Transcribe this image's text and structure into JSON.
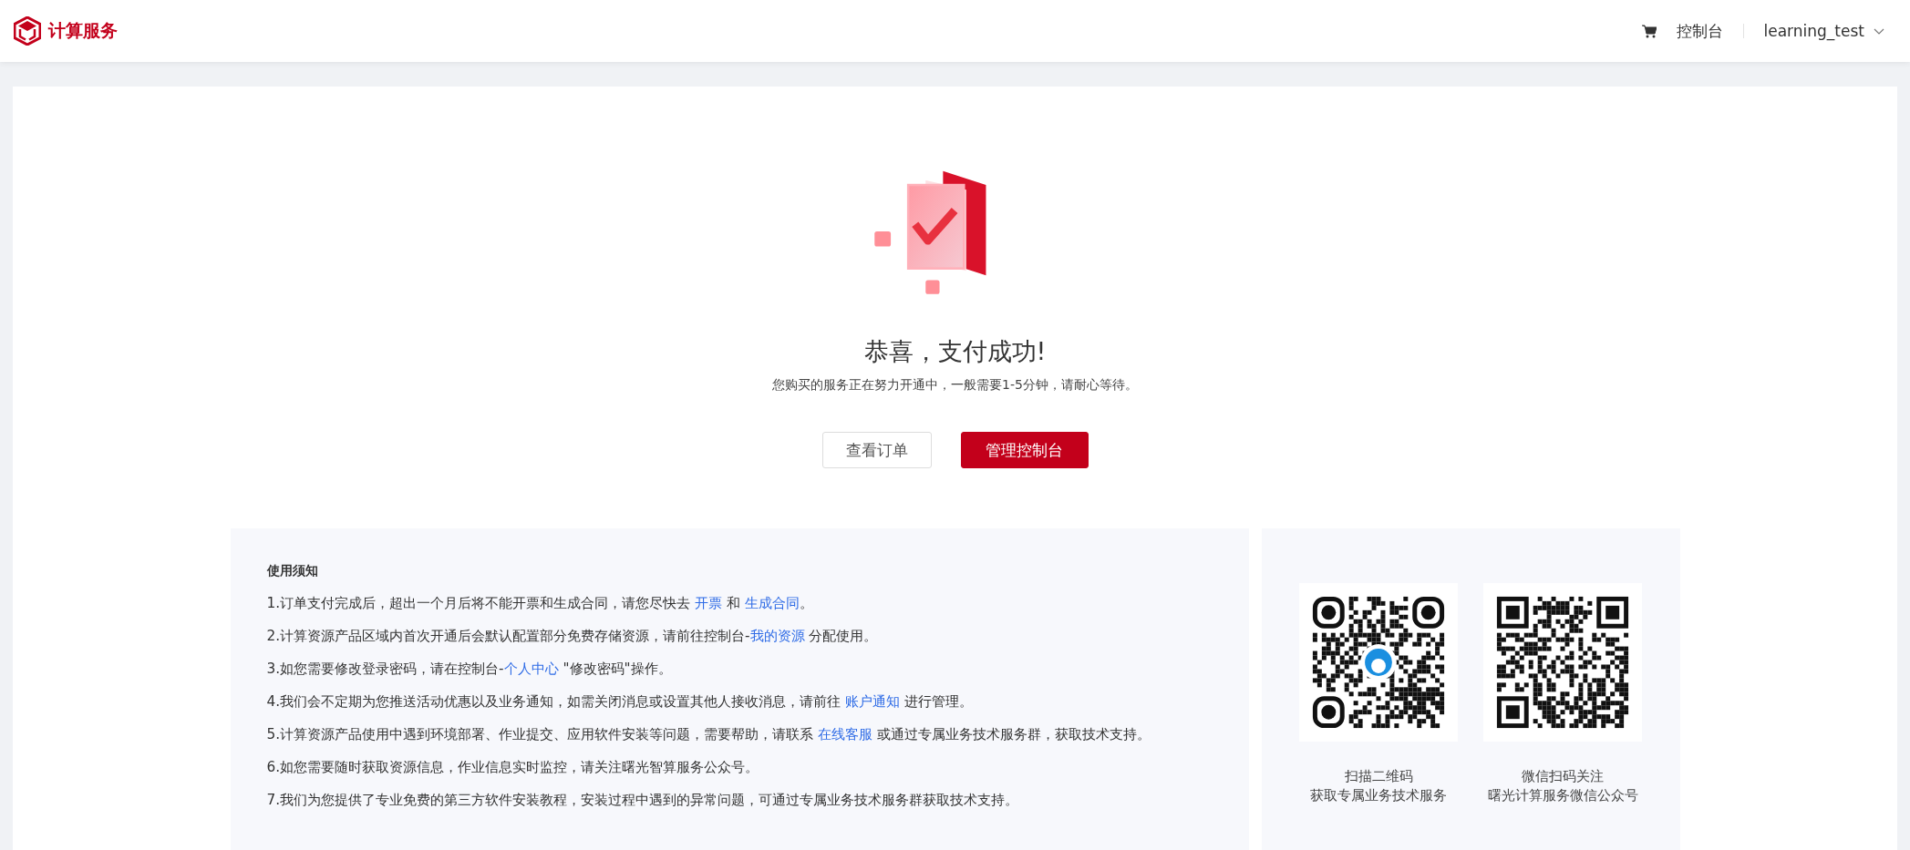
{
  "header": {
    "logo_text": "计算服务",
    "console_link": "控制台",
    "user": "learning_test"
  },
  "result": {
    "title": "恭喜，支付成功!",
    "subtitle": "您购买的服务正在努力开通中，一般需要1-5分钟，请耐心等待。",
    "buttons": [
      {
        "label": "查看订单",
        "kind": "secondary"
      },
      {
        "label": "管理控制台",
        "kind": "primary"
      }
    ]
  },
  "notice": {
    "title": "使用须知",
    "items": [
      [
        {
          "kind": "text",
          "text": "1.订单支付完成后，超出一个月后将不能开票和生成合同，请您尽快去 "
        },
        {
          "kind": "link",
          "text": "开票"
        },
        {
          "kind": "text",
          "text": " 和 "
        },
        {
          "kind": "link",
          "text": "生成合同"
        },
        {
          "kind": "text",
          "text": "。"
        }
      ],
      [
        {
          "kind": "text",
          "text": "2.计算资源产品区域内首次开通后会默认配置部分免费存储资源，请前往控制台-"
        },
        {
          "kind": "link",
          "text": "我的资源"
        },
        {
          "kind": "text",
          "text": " 分配使用。"
        }
      ],
      [
        {
          "kind": "text",
          "text": "3.如您需要修改登录密码，请在控制台-"
        },
        {
          "kind": "link",
          "text": "个人中心"
        },
        {
          "kind": "text",
          "text": " \"修改密码\"操作。"
        }
      ],
      [
        {
          "kind": "text",
          "text": "4.我们会不定期为您推送活动优惠以及业务通知，如需关闭消息或设置其他人接收消息，请前往 "
        },
        {
          "kind": "link",
          "text": "账户通知"
        },
        {
          "kind": "text",
          "text": " 进行管理。"
        }
      ],
      [
        {
          "kind": "text",
          "text": "5.计算资源产品使用中遇到环境部署、作业提交、应用软件安装等问题，需要帮助，请联系 "
        },
        {
          "kind": "link",
          "text": "在线客服"
        },
        {
          "kind": "text",
          "text": " 或通过专属业务技术服务群，获取技术支持。"
        }
      ],
      [
        {
          "kind": "text",
          "text": "6.如您需要随时获取资源信息，作业信息实时监控，请关注曙光智算服务公众号。"
        }
      ],
      [
        {
          "kind": "text",
          "text": "7.我们为您提供了专业免费的第三方软件安装教程，安装过程中遇到的异常问题，可通过专属业务技术服务群获取技术支持。"
        }
      ]
    ]
  },
  "qr_codes": [
    {
      "kind": "support",
      "lines": [
        "扫描二维码",
        "获取专属业务技术服务"
      ]
    },
    {
      "kind": "plain",
      "lines": [
        "微信扫码关注",
        "曙光计算服务微信公众号"
      ]
    }
  ]
}
